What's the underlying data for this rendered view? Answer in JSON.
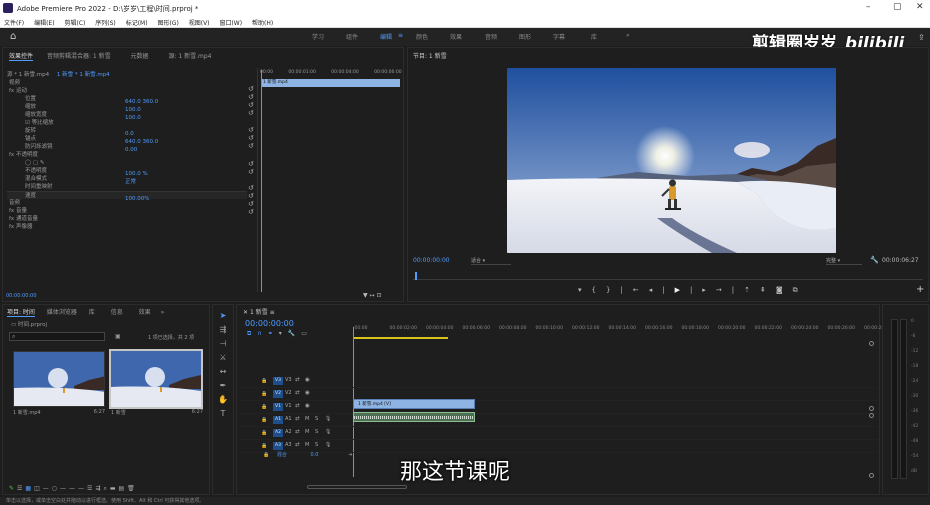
{
  "titlebar": {
    "title": "Adobe Premiere Pro 2022 - D:\\岁岁\\工程\\时间.prproj *",
    "minimize": "–",
    "maximize": "▢",
    "close": "✕"
  },
  "menu": [
    "文件(F)",
    "编辑(E)",
    "剪辑(C)",
    "序列(S)",
    "标记(M)",
    "图形(G)",
    "视图(V)",
    "窗口(W)",
    "帮助(H)"
  ],
  "workspaces": {
    "items": [
      "学习",
      "组件",
      "编辑",
      "颜色",
      "效果",
      "音频",
      "图形",
      "字幕",
      "库"
    ],
    "active": "编辑",
    "more": "»"
  },
  "watermark": {
    "channel": "剪辑圈岁岁",
    "brand": "bilibili"
  },
  "effect_controls": {
    "tabs": [
      "效果控件",
      "音频剪辑混合器: 1 新雪",
      "元数据",
      "源: 1 新雪.mp4"
    ],
    "source": "源 * 1 新雪.mp4",
    "sequence": "1 新雪 * 1 新雪.mp4",
    "mini_timeline_times": [
      "00:00",
      "00:00:01:00",
      "00:00:04:00",
      "00:00:06:00"
    ],
    "clip_label": "1 新雪.mp4",
    "rows": [
      {
        "label": "视频",
        "value": ""
      },
      {
        "label": "fx  运动",
        "value": ""
      },
      {
        "label": "位置",
        "value": "640.0   360.0"
      },
      {
        "label": "缩放",
        "value": "100.0"
      },
      {
        "label": "缩放宽度",
        "value": "100.0"
      },
      {
        "label": "☑ 等比缩放",
        "value": ""
      },
      {
        "label": "旋转",
        "value": "0.0"
      },
      {
        "label": "锚点",
        "value": "640.0   360.0"
      },
      {
        "label": "防闪烁滤镜",
        "value": "0.00"
      },
      {
        "label": "fx  不透明度",
        "value": ""
      },
      {
        "label": "◯ ▢ ✎",
        "value": ""
      },
      {
        "label": "不透明度",
        "value": "100.0 %"
      },
      {
        "label": "混合模式",
        "value": "正常"
      },
      {
        "label": "时间重映射",
        "value": ""
      },
      {
        "label": "速度",
        "value": "100.00%"
      },
      {
        "label": "音频",
        "value": ""
      },
      {
        "label": "fx  音量",
        "value": ""
      },
      {
        "label": "fx  通道音量",
        "value": ""
      },
      {
        "label": "fx  声像器",
        "value": ""
      }
    ],
    "timecode": "00:00:00:00"
  },
  "program": {
    "title": "节目: 1 新雪",
    "timecode": "00:00:00:00",
    "fit": "适合",
    "quality": "完整",
    "duration": "00:00:06:27"
  },
  "project": {
    "tabs": [
      "项目: 时间",
      "媒体浏览器",
      "库",
      "信息",
      "效果"
    ],
    "folder": "时间.prproj",
    "search_placeholder": "",
    "selection": "1 项已选择，共 2 项",
    "items": [
      {
        "name": "1 新雪.mp4",
        "duration": "6:27"
      },
      {
        "name": "1 新雪",
        "duration": "6:27"
      }
    ]
  },
  "timeline": {
    "tab": "1 新雪",
    "timecode": "00:00:00:00",
    "ruler": [
      ":00:00",
      "00:00:02:00",
      "00:00:04:00",
      "00:00:06:00",
      "00:00:08:00",
      "00:00:10:00",
      "00:00:12:00",
      "00:00:14:00",
      "00:00:16:00",
      "00:00:18:00",
      "00:00:20:00",
      "00:00:22:00",
      "00:00:24:00",
      "00:00:26:00",
      "00:00:28:00"
    ],
    "video_tracks": [
      "V3",
      "V2",
      "V1"
    ],
    "audio_tracks": [
      "A1",
      "A2",
      "A3"
    ],
    "mix_label": "混合",
    "mix_value": "0.0",
    "video_clip": "1 新雪.mp4 [V]",
    "meter_ticks": [
      "0",
      "-6",
      "-12",
      "-18",
      "-24",
      "-30",
      "-36",
      "-42",
      "-48",
      "-54",
      "dB"
    ]
  },
  "subtitle": "那这节课呢",
  "status": "单击以选择，或单击空白处并拖动以进行框选。使用 Shift、Alt 和 Ctrl 可获得其他选项。"
}
